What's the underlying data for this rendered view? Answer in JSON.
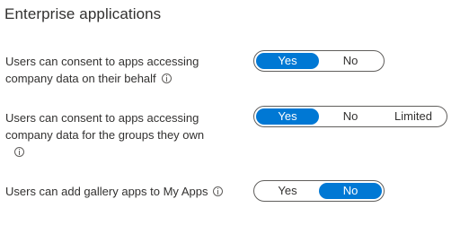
{
  "section": {
    "title": "Enterprise applications"
  },
  "settings": [
    {
      "label_line1": "Users can consent to apps accessing",
      "label_line2": "company data on their behalf",
      "options": [
        "Yes",
        "No"
      ],
      "selected": "Yes"
    },
    {
      "label_line1": "Users can consent to apps accessing",
      "label_line2": "company data for the groups they own",
      "options": [
        "Yes",
        "No",
        "Limited"
      ],
      "selected": "Yes"
    },
    {
      "label_line1": "Users can add gallery apps to My Apps",
      "options": [
        "Yes",
        "No"
      ],
      "selected": "No"
    }
  ],
  "colors": {
    "accent": "#0078d4",
    "text": "#323130",
    "border": "#605e5c"
  },
  "icons": {
    "info": "info-icon"
  }
}
